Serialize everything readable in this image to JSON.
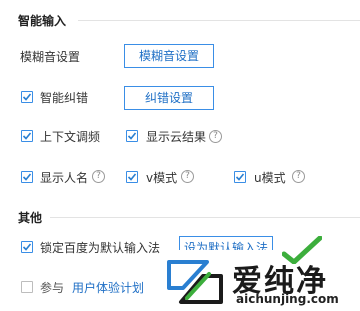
{
  "sections": {
    "smart_input": "智能输入",
    "other": "其他"
  },
  "fuzzy": {
    "label": "模糊音设置",
    "button": "模糊音设置"
  },
  "correction": {
    "label": "智能纠错",
    "checked": true,
    "button": "纠错设置"
  },
  "context_association": {
    "label": "上下文调频",
    "checked": true
  },
  "cloud_results": {
    "label": "显示云结果",
    "checked": true
  },
  "show_names": {
    "label": "显示人名",
    "checked": true
  },
  "v_mode": {
    "label": "v模式",
    "checked": true
  },
  "u_mode": {
    "label": "u模式",
    "checked": true
  },
  "lock_default": {
    "label": "锁定百度为默认输入法",
    "checked": true,
    "button": "设为默认输入法"
  },
  "experience": {
    "label": "参与",
    "checked": false,
    "link": "用户体验计划"
  },
  "help_glyph": "?",
  "watermark": {
    "text": "爱纯净",
    "url": "aichunjing.com"
  },
  "colors": {
    "accent": "#3a8ee6",
    "link": "#1f6fc5",
    "logo_green": "#3cae3c",
    "logo_blue": "#2a7fd1"
  }
}
